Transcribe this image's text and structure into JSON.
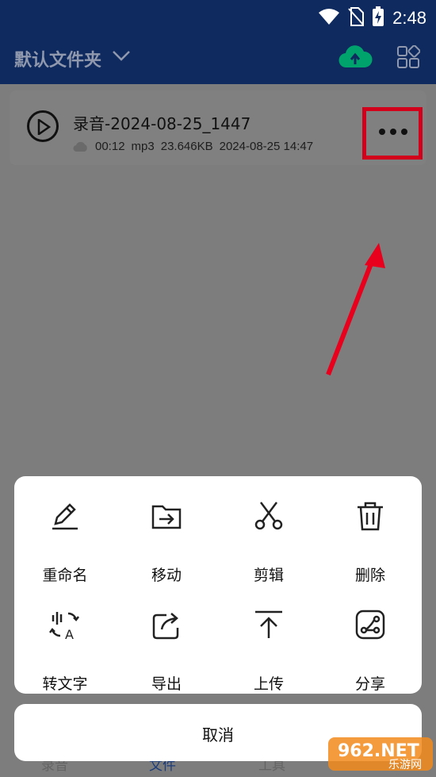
{
  "status_bar": {
    "time": "2:48"
  },
  "app_bar": {
    "folder_title": "默认文件夹"
  },
  "recording": {
    "name": "录音-2024-08-25_1447",
    "duration": "00:12",
    "format": "mp3",
    "size": "23.646KB",
    "datetime": "2024-08-25 14:47"
  },
  "bottom_nav": {
    "items": [
      "录音",
      "文件",
      "工具"
    ]
  },
  "actions": [
    {
      "label": "重命名",
      "icon": "pencil-icon"
    },
    {
      "label": "移动",
      "icon": "folder-move-icon"
    },
    {
      "label": "剪辑",
      "icon": "scissors-icon"
    },
    {
      "label": "删除",
      "icon": "trash-icon"
    },
    {
      "label": "转文字",
      "icon": "speech-to-text-icon"
    },
    {
      "label": "导出",
      "icon": "export-icon"
    },
    {
      "label": "上传",
      "icon": "upload-icon"
    },
    {
      "label": "分享",
      "icon": "share-icon"
    }
  ],
  "cancel_label": "取消",
  "watermark": {
    "text": "962.NET",
    "subtext": "乐游网"
  },
  "colors": {
    "app_bar": "#0f2a5f",
    "overlay": "#7d7d7d",
    "highlight": "#d3001c",
    "cloud_accent": "#00a36c"
  }
}
